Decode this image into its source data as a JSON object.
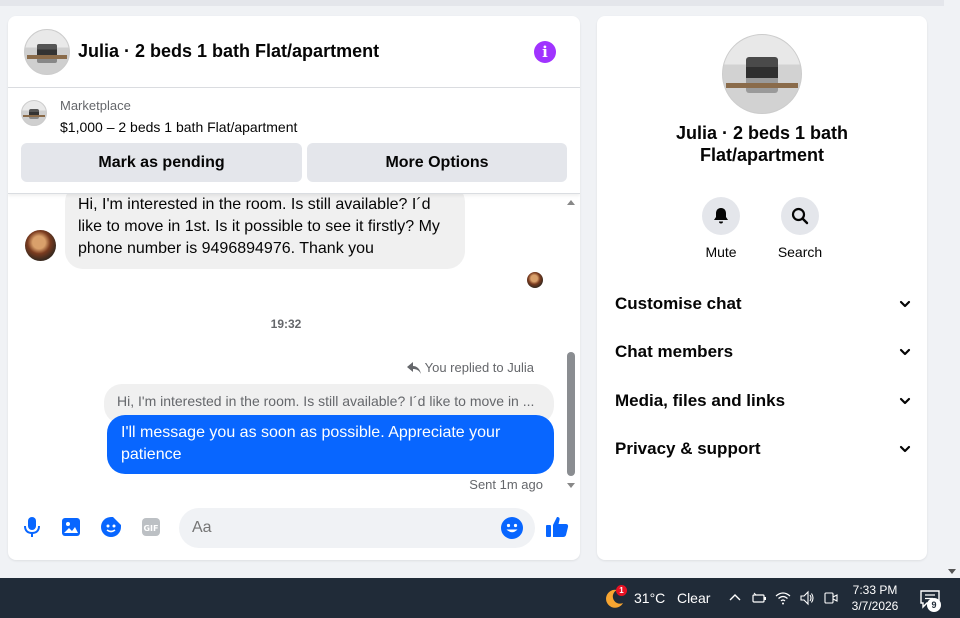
{
  "header": {
    "title": "Julia · 2 beds 1 bath Flat/apartment"
  },
  "marketplace": {
    "label": "Marketplace",
    "listing": "$1,000 – 2 beds 1 bath Flat/apartment",
    "mark_pending_label": "Mark as pending",
    "more_options_label": "More Options"
  },
  "messages": {
    "incoming_text": "Hi, I'm interested in the room. Is still available? I´d like to move in 1st. Is it possible to see it firstly? My phone number is 9496894976. Thank you",
    "timestamp": "19:32",
    "replied_label": "You replied to Julia",
    "quoted_text": "Hi, I'm interested in the room. Is still available? I´d like to move in ...",
    "outgoing_text": "I'll message you as soon as possible. Appreciate your patience",
    "status": "Sent 1m ago"
  },
  "composer": {
    "placeholder": "Aa"
  },
  "info_panel": {
    "name": "Julia · 2 beds 1 bath Flat/apartment",
    "actions": [
      {
        "label": "Mute",
        "icon": "bell-icon"
      },
      {
        "label": "Search",
        "icon": "search-icon"
      }
    ],
    "sections": [
      {
        "label": "Customise chat"
      },
      {
        "label": "Chat members"
      },
      {
        "label": "Media, files and links"
      },
      {
        "label": "Privacy & support"
      }
    ]
  },
  "taskbar": {
    "weather_temp": "31°C",
    "weather_condition": "Clear",
    "weather_badge": "1",
    "time": "7:33 PM",
    "date": "3/7/2026",
    "notification_count": "9"
  },
  "colors": {
    "accent": "#0866ff",
    "info": "#a033ff",
    "taskbar": "#202b38"
  }
}
